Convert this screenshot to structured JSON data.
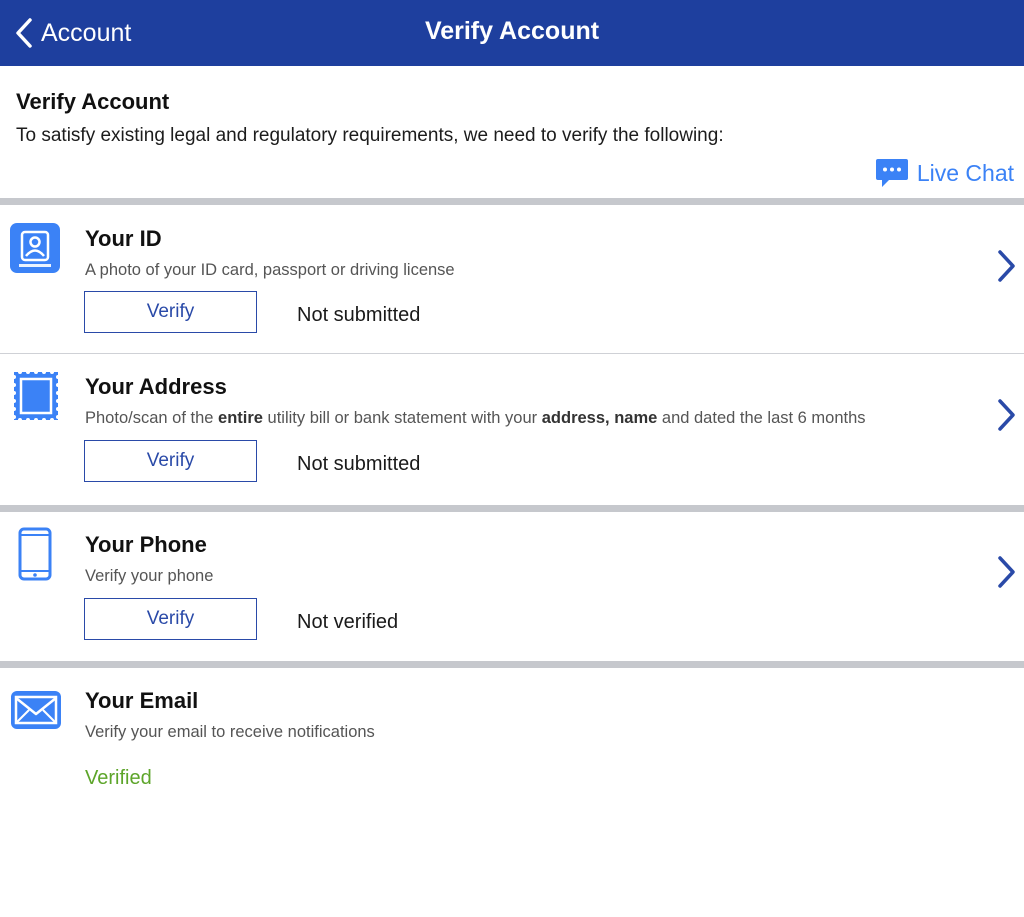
{
  "nav": {
    "back_label": "Account",
    "title": "Verify Account"
  },
  "intro": {
    "title": "Verify Account",
    "text": "To satisfy existing legal and regulatory requirements, we need to verify the following:",
    "live_chat_label": "Live Chat"
  },
  "sections": [
    {
      "title": "Your ID",
      "description": "A photo of your ID card, passport or driving license",
      "button_label": "Verify",
      "status": "Not submitted"
    },
    {
      "title": "Your Address",
      "description_parts": {
        "p1": "Photo/scan of the ",
        "b1": "entire",
        "p2": " utility bill or bank statement with your ",
        "b2": "address, name",
        "p3": " and dated the last 6 months"
      },
      "button_label": "Verify",
      "status": "Not submitted"
    },
    {
      "title": "Your Phone",
      "description": "Verify your phone",
      "button_label": "Verify",
      "status": "Not verified"
    },
    {
      "title": "Your Email",
      "description": "Verify your email to receive notifications",
      "status": "Verified"
    }
  ],
  "colors": {
    "navbar": "#1e3f9e",
    "accent_blue": "#3b82f6",
    "button_blue": "#2a4aa8",
    "verified_green": "#5da52a",
    "separator": "#c6c8cd"
  },
  "icons": {
    "back": "chevron-left-icon",
    "live_chat": "chat-bubble-icon",
    "id": "id-card-icon",
    "address": "stamp-document-icon",
    "phone": "phone-icon",
    "email": "envelope-icon",
    "row_arrow": "chevron-right-icon"
  }
}
